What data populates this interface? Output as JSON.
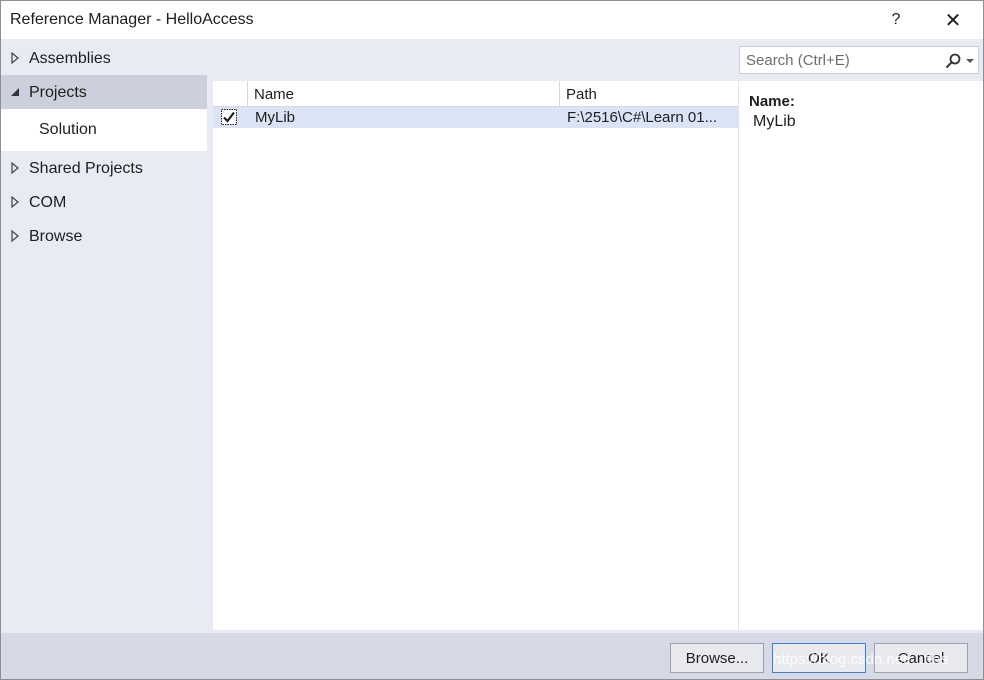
{
  "window": {
    "title": "Reference Manager - HelloAccess",
    "help_glyph": "?",
    "close_glyph": "✕"
  },
  "nav": {
    "items": [
      {
        "label": "Assemblies",
        "expanded": false
      },
      {
        "label": "Projects",
        "expanded": true,
        "selected": true
      },
      {
        "label": "Shared Projects",
        "expanded": false
      },
      {
        "label": "COM",
        "expanded": false
      },
      {
        "label": "Browse",
        "expanded": false
      }
    ],
    "sub_item": {
      "label": "Solution"
    }
  },
  "search": {
    "placeholder": "Search (Ctrl+E)",
    "icon": "search-icon"
  },
  "list": {
    "columns": [
      "Name",
      "Path"
    ],
    "rows": [
      {
        "checked": true,
        "name": "MyLib",
        "path": "F:\\2516\\C#\\Learn 01..."
      }
    ]
  },
  "details": {
    "name_label": "Name:",
    "name_value": "MyLib"
  },
  "buttons": {
    "browse": "Browse...",
    "ok": "OK",
    "cancel": "Cancel"
  },
  "watermark": "https://blog.csdn.net/...tfos",
  "colors": {
    "selected_nav": "#ccd0dc",
    "selected_row": "#dbe3f6",
    "dialog_bg": "#e8ebf4",
    "default_button_border": "#3c7fd8"
  }
}
